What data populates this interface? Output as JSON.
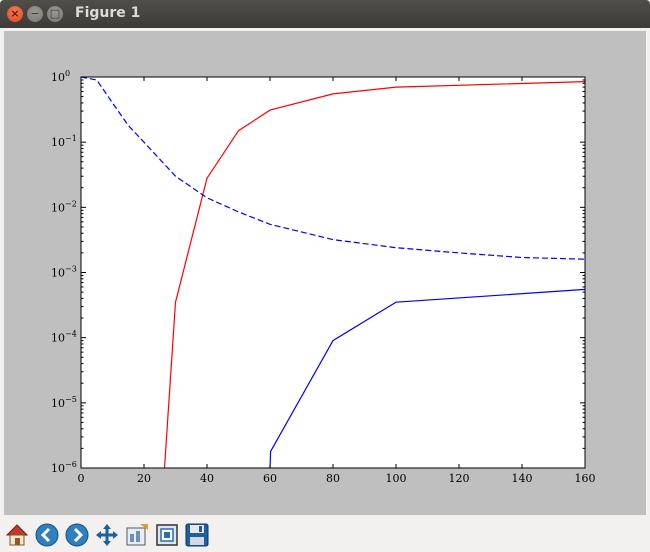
{
  "window": {
    "title": "Figure 1"
  },
  "toolbar": {
    "buttons": [
      {
        "name": "home",
        "icon": "home-icon"
      },
      {
        "name": "back",
        "icon": "back-arrow-icon"
      },
      {
        "name": "forward",
        "icon": "forward-arrow-icon"
      },
      {
        "name": "pan",
        "icon": "move-arrows-icon"
      },
      {
        "name": "configure-subplots",
        "icon": "subplots-config-icon"
      },
      {
        "name": "zoom",
        "icon": "zoom-rect-icon"
      },
      {
        "name": "save",
        "icon": "floppy-disk-icon"
      }
    ]
  },
  "chart_data": {
    "type": "line",
    "xlim": [
      0,
      160
    ],
    "ylim": [
      1e-06,
      1
    ],
    "yscale": "log",
    "grid": false,
    "x_ticks": [
      "0",
      "20",
      "40",
      "60",
      "80",
      "100",
      "120",
      "140",
      "160"
    ],
    "y_ticks": [
      {
        "base": "10",
        "exp": "−6"
      },
      {
        "base": "10",
        "exp": "−5"
      },
      {
        "base": "10",
        "exp": "−4"
      },
      {
        "base": "10",
        "exp": "−3"
      },
      {
        "base": "10",
        "exp": "−2"
      },
      {
        "base": "10",
        "exp": "−1"
      },
      {
        "base": "10",
        "exp": "0"
      }
    ],
    "series": [
      {
        "color": "#ff0000",
        "dash": "solid",
        "x": [
          26.5,
          30,
          40,
          50,
          60,
          80,
          100,
          160
        ],
        "y": [
          1e-06,
          0.00035,
          0.028,
          0.15,
          0.31,
          0.55,
          0.7,
          0.85
        ]
      },
      {
        "color": "#0000ff",
        "dash": "dashed",
        "x": [
          0,
          5,
          10,
          15,
          20,
          30,
          40,
          50,
          60,
          80,
          100,
          120,
          140,
          160
        ],
        "y": [
          1.0,
          0.9,
          0.4,
          0.18,
          0.1,
          0.03,
          0.014,
          0.0085,
          0.0055,
          0.0032,
          0.0024,
          0.002,
          0.0017,
          0.0016
        ]
      },
      {
        "color": "#0000ff",
        "dash": "solid",
        "x": [
          60,
          60.2,
          80,
          100,
          160
        ],
        "y": [
          1e-06,
          1.8e-06,
          9e-05,
          0.00035,
          0.00055
        ]
      }
    ]
  }
}
